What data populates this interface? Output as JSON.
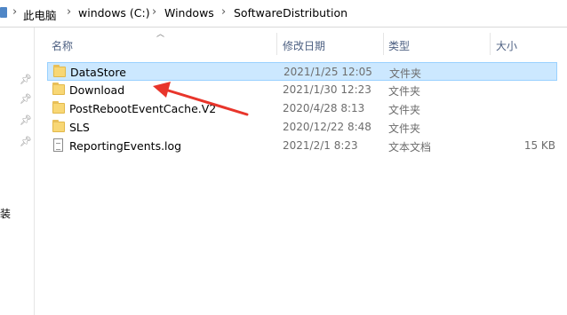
{
  "breadcrumb": {
    "items": [
      "此电脑",
      "windows (C:)",
      "Windows",
      "SoftwareDistribution"
    ],
    "separator": "›"
  },
  "nav": {
    "partial_label": "装",
    "pins": [
      "pin-icon",
      "pin-icon",
      "pin-icon",
      "pin-icon"
    ]
  },
  "columns": {
    "name": "名称",
    "date": "修改日期",
    "type": "类型",
    "size": "大小"
  },
  "rows": [
    {
      "name": "DataStore",
      "date": "2021/1/25 12:05",
      "type": "文件夹",
      "size": "",
      "icon": "folder-icon",
      "selected": true
    },
    {
      "name": "Download",
      "date": "2021/1/30 12:23",
      "type": "文件夹",
      "size": "",
      "icon": "folder-icon",
      "selected": false
    },
    {
      "name": "PostRebootEventCache.V2",
      "date": "2020/4/28 8:13",
      "type": "文件夹",
      "size": "",
      "icon": "folder-icon",
      "selected": false
    },
    {
      "name": "SLS",
      "date": "2020/12/22 8:48",
      "type": "文件夹",
      "size": "",
      "icon": "folder-icon",
      "selected": false
    },
    {
      "name": "ReportingEvents.log",
      "date": "2021/2/1 8:23",
      "type": "文本文档",
      "size": "15 KB",
      "icon": "text-file-icon",
      "selected": false
    }
  ],
  "colors": {
    "selection_bg": "#cce8ff",
    "selection_border": "#99d1ff",
    "header_text": "#4d6082",
    "annotation_arrow": "#e8352b"
  }
}
